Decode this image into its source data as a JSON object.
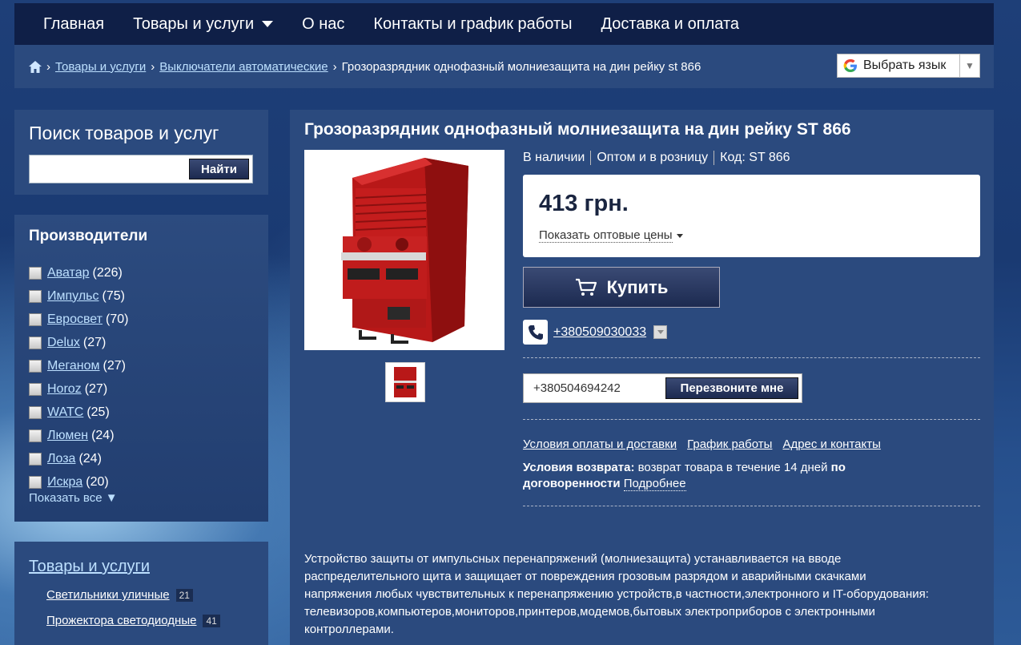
{
  "nav": {
    "items": [
      "Главная",
      "Товары и услуги",
      "О нас",
      "Контакты и график работы",
      "Доставка и оплата"
    ]
  },
  "breadcrumb": {
    "sep": "›",
    "items": [
      "Товары и услуги",
      "Выключатели автоматические"
    ],
    "current": "Грозоразрядник однофазный молниезащита на дин рейку st 866"
  },
  "lang": {
    "label": "Выбрать язык"
  },
  "search": {
    "title": "Поиск товаров и услуг",
    "button": "Найти",
    "value": ""
  },
  "manufacturers": {
    "title": "Производители",
    "items": [
      {
        "name": "Аватар",
        "count": "(226)"
      },
      {
        "name": "Импульс",
        "count": "(75)"
      },
      {
        "name": "Евросвет",
        "count": "(70)"
      },
      {
        "name": "Delux",
        "count": "(27)"
      },
      {
        "name": "Меганом",
        "count": "(27)"
      },
      {
        "name": "Horoz ",
        "count": "(27)"
      },
      {
        "name": "WATC",
        "count": "(25)"
      },
      {
        "name": "Люмен",
        "count": "(24)"
      },
      {
        "name": "Лоза",
        "count": "(24)"
      },
      {
        "name": "Искра",
        "count": "(20)"
      }
    ],
    "show_all": "Показать все ▼"
  },
  "goods": {
    "title": "Товары и услуги",
    "items": [
      {
        "label": "Светильники уличные",
        "count": "21"
      },
      {
        "label": "Прожектора светодиодные",
        "count": "41"
      }
    ]
  },
  "product": {
    "title": "Грозоразрядник однофазный молниезащита на дин рейку ST 866",
    "availability": "В наличии",
    "sale_type": "Оптом и в розницу",
    "code": "Код: ST 866",
    "price": "413 грн.",
    "wholesale_link": "Показать оптовые цены",
    "buy_label": "Купить",
    "phone": "+380509030033",
    "callback_value": "+380504694242",
    "callback_button": "Перезвоните мне",
    "links": [
      "Условия оплаты и доставки",
      "График работы",
      "Адрес и контакты"
    ],
    "return_label": "Условия возврата:",
    "return_text": " возврат товара в течение 14 дней ",
    "return_bold2": "по договоренности",
    "return_more": "Подробнее",
    "description": "Устройство защиты от импульсных перенапряжений (молниезащита) устанавливается на вводе распределительного щита и защищает от повреждения грозовым разрядом и аварийными скачками напряжения любых чувствительных к перенапряжению устройств,в частности,электронного и IT-оборудования: телевизоров,компьютеров,мониторов,принтеров,модемов,бытовых электроприборов с электронными контроллерами."
  }
}
